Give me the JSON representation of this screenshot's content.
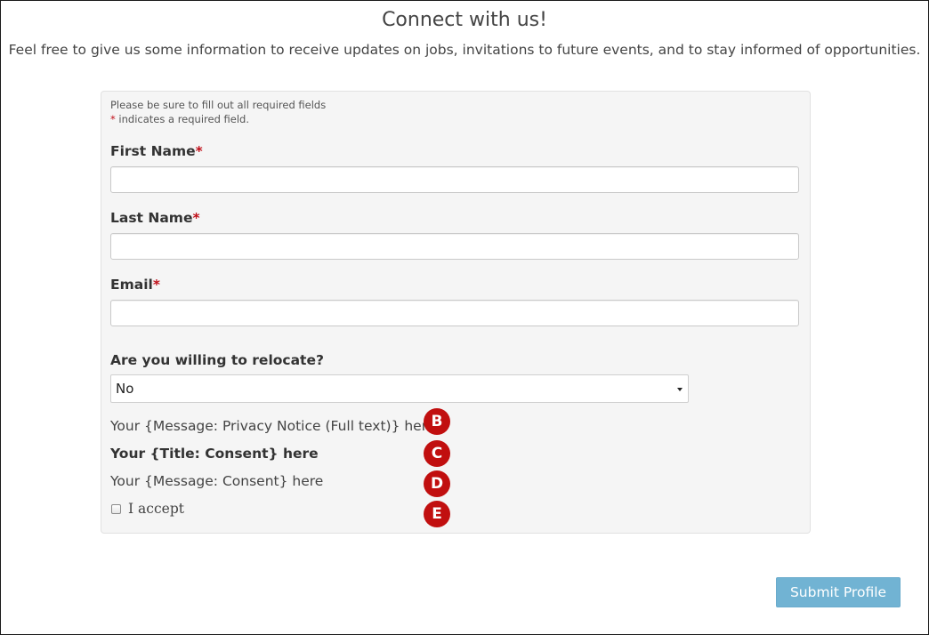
{
  "page": {
    "title": "Connect with us!",
    "intro": "Feel free to give us some information to receive updates on jobs, invitations to future events, and to stay informed of opportunities."
  },
  "form": {
    "note_required": "Please be sure to fill out all required fields",
    "note_asterisk": "*",
    "note_indicates": " indicates a required field.",
    "required_mark": "*",
    "fields": {
      "first_name": {
        "label": "First Name",
        "value": "",
        "placeholder": ""
      },
      "last_name": {
        "label": "Last Name",
        "value": "",
        "placeholder": ""
      },
      "email": {
        "label": "Email",
        "value": "",
        "placeholder": ""
      }
    },
    "relocate": {
      "label": "Are you willing to relocate?",
      "selected": "No"
    },
    "privacy_message": "Your {Message: Privacy Notice (Full text)} here",
    "consent_title": "Your {Title: Consent} here",
    "consent_message": "Your {Message: Consent} here",
    "accept_label": "I accept",
    "accept_checked": false
  },
  "markers": {
    "b": "B",
    "c": "C",
    "d": "D",
    "e": "E"
  },
  "submit_label": "Submit Profile",
  "colors": {
    "required": "#c0101a",
    "marker": "#c10f0f",
    "submit_button": "#71b3d3",
    "panel_background": "#f5f5f5"
  }
}
